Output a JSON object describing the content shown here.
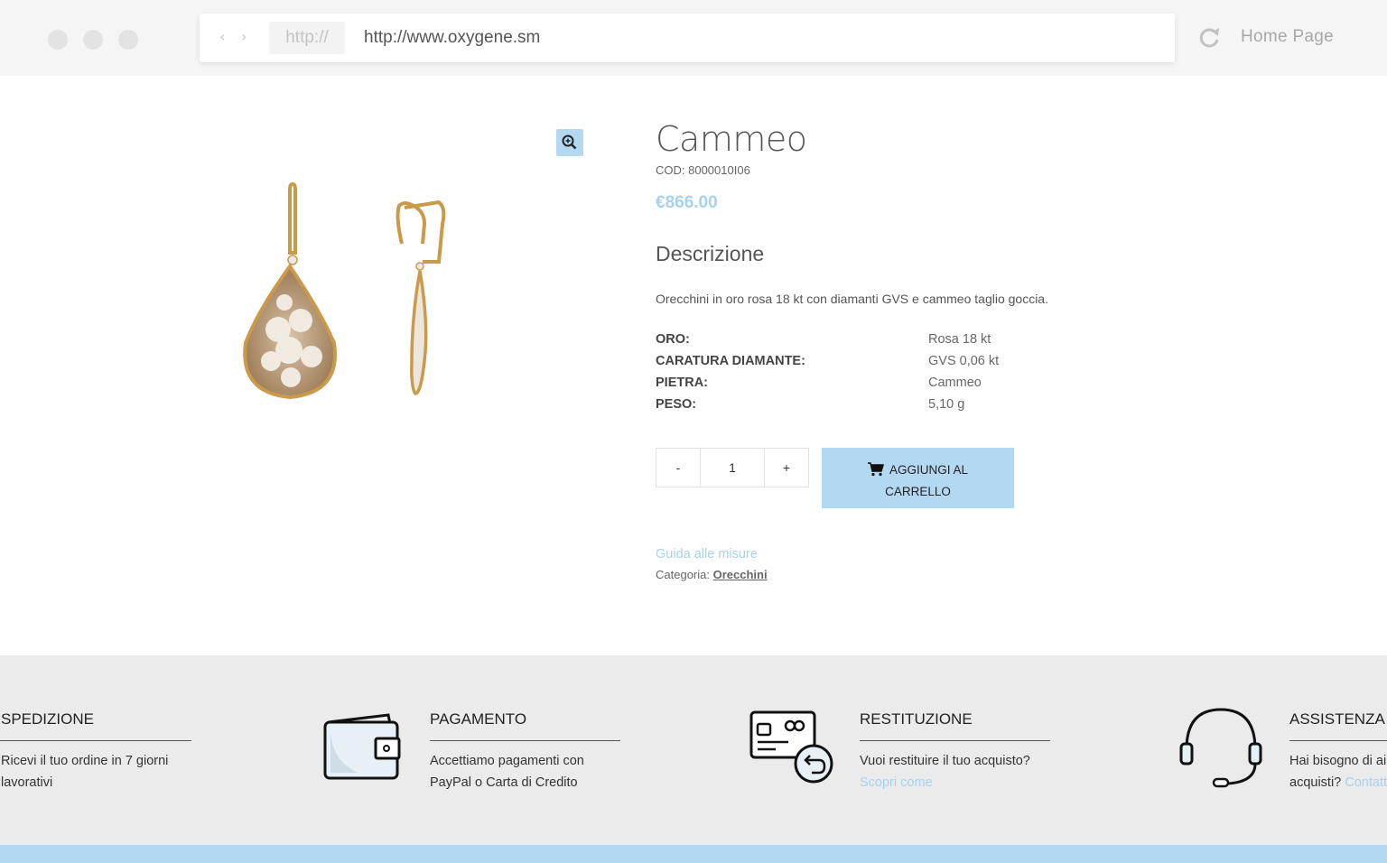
{
  "browser": {
    "protocol": "http://",
    "url": "http://www.oxygene.sm",
    "home_label": "Home Page"
  },
  "product": {
    "title": "Cammeo",
    "sku": "COD: 8000010I06",
    "price": "€866.00",
    "description_title": "Descrizione",
    "description": "Orecchini in oro rosa 18 kt con diamanti GVS e cammeo taglio goccia.",
    "specs": [
      {
        "label": "ORO:",
        "value": "Rosa 18 kt"
      },
      {
        "label": "CARATURA DIAMANTE:",
        "value": "GVS 0,06 kt"
      },
      {
        "label": "PIETRA:",
        "value": "Cammeo"
      },
      {
        "label": "PESO:",
        "value": "5,10 g"
      }
    ],
    "quantity": {
      "minus": "-",
      "value": "1",
      "plus": "+"
    },
    "add_to_cart_line1": "AGGIUNGI AL",
    "add_to_cart_line2": "CARRELLO",
    "size_guide": "Guida alle misure",
    "category_label": "Categoria:",
    "category_value": "Orecchini"
  },
  "features": [
    {
      "icon": "truck-icon",
      "title": "SPEDIZIONE",
      "line1": "Ricevi il tuo ordine in 7 giorni",
      "line2": "lavorativi",
      "link": ""
    },
    {
      "icon": "wallet-icon",
      "title": "PAGAMENTO",
      "line1": "Accettiamo pagamenti con",
      "line2": "PayPal o Carta di Credito",
      "link": ""
    },
    {
      "icon": "card-return-icon",
      "title": "RESTITUZIONE",
      "line1": "Vuoi restituire il tuo acquisto?",
      "line2": "",
      "link": "Scopri come"
    },
    {
      "icon": "headset-icon",
      "title": "ASSISTENZA",
      "line1": "Hai bisogno di aiuto con i tuoi",
      "line2": "acquisti? ",
      "link": "Contattaci"
    }
  ],
  "colors": {
    "accent": "#b3d8f2",
    "price": "#a7d1ee",
    "footer_bg": "#ebebeb",
    "chrome_bg": "#f5f5f5"
  }
}
